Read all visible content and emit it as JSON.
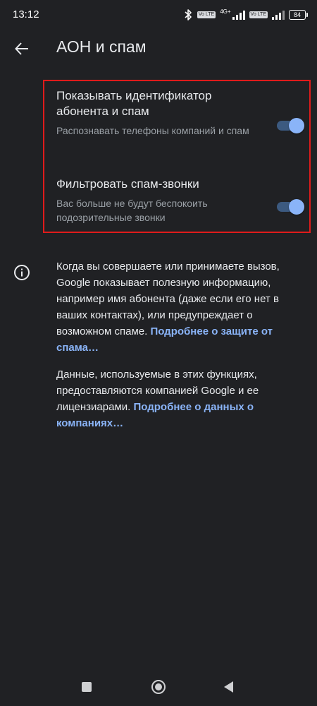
{
  "status_bar": {
    "time": "13:12",
    "lte_label": "Vo LTE",
    "network_type": "4G+",
    "battery_level": "84",
    "icons": [
      "bluetooth-icon",
      "volte-icon",
      "signal-icon",
      "battery-icon"
    ]
  },
  "header": {
    "back_icon": "arrow-left-icon",
    "title": "АОН и спам"
  },
  "settings": [
    {
      "title": "Показывать идентификатор абонента и спам",
      "subtitle": "Распознавать телефоны компаний и спам",
      "enabled": true
    },
    {
      "title": "Фильтровать спам-звонки",
      "subtitle": "Вас больше не будут беспокоить подозрительные звонки",
      "enabled": true
    }
  ],
  "info": {
    "icon": "info-icon",
    "paragraph1_text": "Когда вы совершаете или принимаете вызов, Google показывает полезную информацию, например имя абонента (даже если его нет в ваших контактах), или предупреждает о возможном спаме. ",
    "paragraph1_link": "Подробнее о защите от спама…",
    "paragraph2_text": "Данные, используемые в этих функциях, предоставляются компанией Google и ее лицензиарами. ",
    "paragraph2_link": "Подробнее о данных о компаниях…"
  },
  "colors": {
    "background": "#202124",
    "toggle_thumb": "#8ab4f8",
    "toggle_track": "#3c5a80",
    "link": "#8ab4f8",
    "highlight_border": "#e01b1b"
  },
  "nav_bar": {
    "icons": [
      "recents-square-icon",
      "home-circle-icon",
      "back-triangle-icon"
    ]
  }
}
